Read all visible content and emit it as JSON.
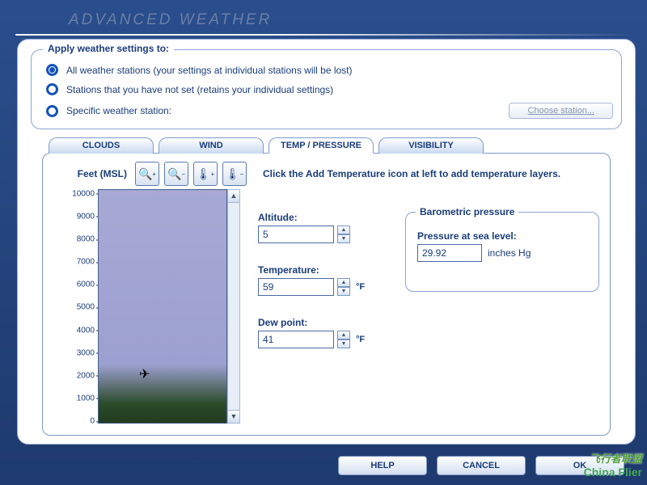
{
  "title": "ADVANCED WEATHER",
  "apply_section": {
    "legend": "Apply weather settings to:",
    "options": [
      "All weather stations (your settings at individual stations will be lost)",
      "Stations that you have not set (retains your individual settings)",
      "Specific weather station:"
    ],
    "selected": 0,
    "choose_btn": "Choose station..."
  },
  "tabs": [
    "CLOUDS",
    "WIND",
    "TEMP / PRESSURE",
    "VISIBILITY"
  ],
  "active_tab": 2,
  "feet_label": "Feet (MSL)",
  "tool_icons": [
    "zoom-in-icon",
    "zoom-out-icon",
    "add-temperature-icon",
    "remove-temperature-icon"
  ],
  "hint": "Click the Add Temperature icon at left to add temperature layers.",
  "chart_data": {
    "type": "bar",
    "ylabel": "Feet (MSL)",
    "ylim": [
      0,
      10000
    ],
    "y_ticks": [
      10000,
      9000,
      8000,
      7000,
      6000,
      5000,
      4000,
      3000,
      2000,
      1000,
      0
    ],
    "plane_altitude_ft": 2100
  },
  "fields": {
    "altitude": {
      "label": "Altitude:",
      "value": "5"
    },
    "temperature": {
      "label": "Temperature:",
      "value": "59",
      "unit": "°F"
    },
    "dewpoint": {
      "label": "Dew point:",
      "value": "41",
      "unit": "°F"
    }
  },
  "pressure": {
    "legend": "Barometric pressure",
    "label": "Pressure at sea level:",
    "value": "29.92",
    "unit": "inches Hg"
  },
  "footer": {
    "help": "HELP",
    "cancel": "CANCEL",
    "ok": "OK"
  },
  "watermark": {
    "line1": "飞行者联盟",
    "line2": "China Flier"
  }
}
